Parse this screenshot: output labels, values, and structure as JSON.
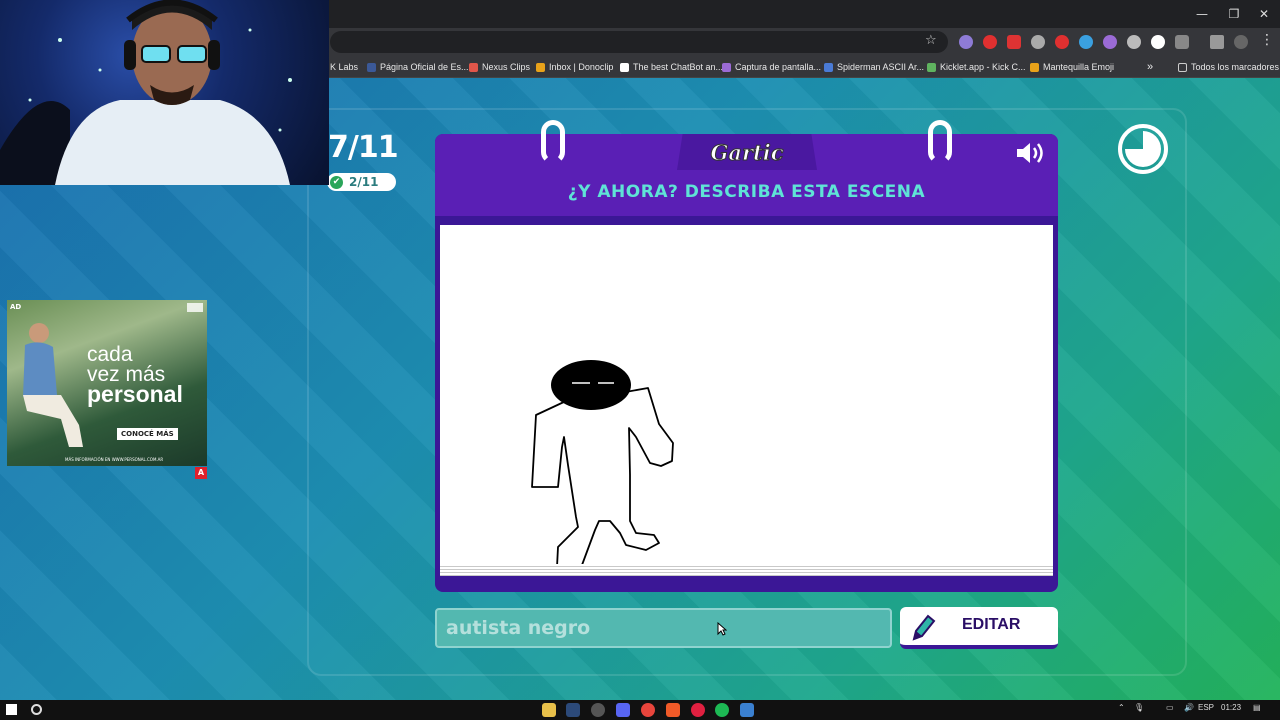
{
  "browser": {
    "bookmarks": [
      {
        "label": "K Labs",
        "color": "#888888"
      },
      {
        "label": "Página Oficial de Es...",
        "color": "#3b5998"
      },
      {
        "label": "Nexus Clips",
        "color": "#e0564a"
      },
      {
        "label": "Inbox | Donoclip",
        "color": "#e8a21a"
      },
      {
        "label": "The best ChatBot an...",
        "color": "#ffffff"
      },
      {
        "label": "Captura de pantalla...",
        "color": "#9b6bd6"
      },
      {
        "label": "Spiderman ASCII Ar...",
        "color": "#4a7bd6"
      },
      {
        "label": "Kicklet.app - Kick C...",
        "color": "#5fb35f"
      },
      {
        "label": "Mantequilla Emoji",
        "color": "#e8a21a"
      }
    ],
    "bookmarks_more": "»",
    "all_bookmarks": "Todos los marcadores",
    "window_controls": {
      "minimize": "—",
      "restore": "❐",
      "close": "✕"
    }
  },
  "game": {
    "round_big": "7/11",
    "round_pill": "2/11",
    "logo": "Gartic",
    "heading": "¿Y AHORA? DESCRIBA ESTA ESCENA",
    "answer_value": "autista negro",
    "edit_label": "EDITAR"
  },
  "ad": {
    "tag": "AD",
    "line1": "cada",
    "line2": "vez más",
    "line3": "personal",
    "cta": "CONOCÉ MÁS",
    "footer": "MÁS INFORMACIÓN EN WWW.PERSONAL.COM.AR",
    "badge": "A"
  },
  "taskbar": {
    "lang": "ESP",
    "time": "01:23"
  }
}
